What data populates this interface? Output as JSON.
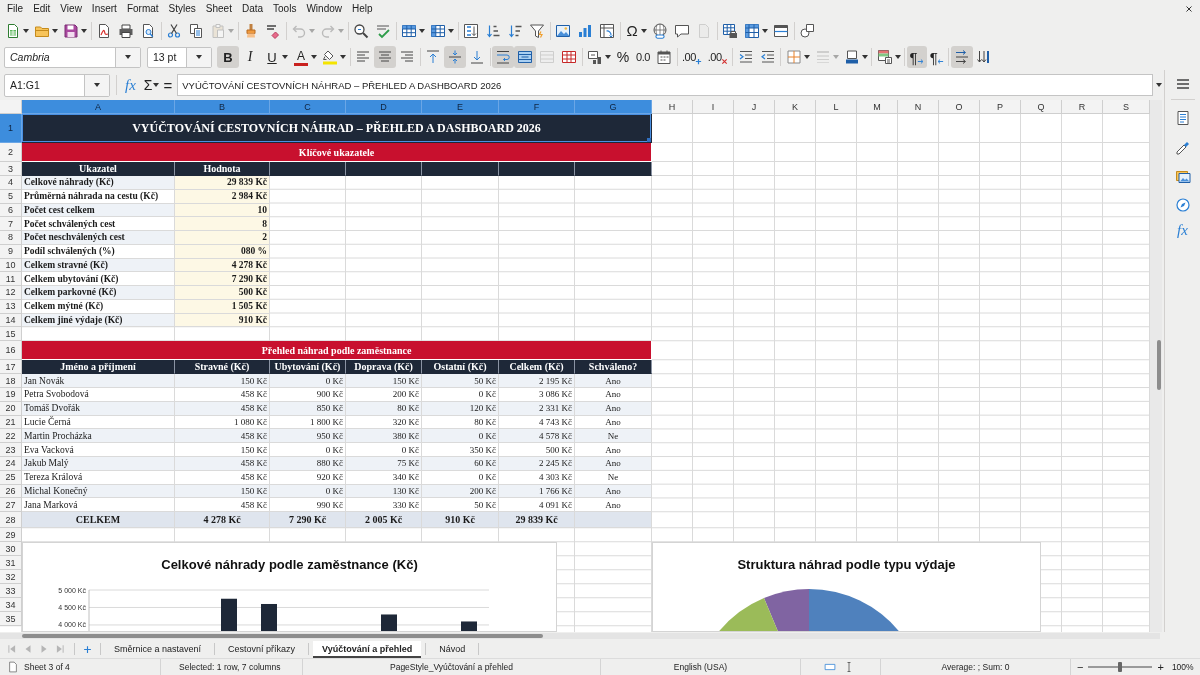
{
  "menu_bar": {
    "items": [
      "File",
      "Edit",
      "View",
      "Insert",
      "Format",
      "Styles",
      "Sheet",
      "Data",
      "Tools",
      "Window",
      "Help"
    ]
  },
  "standard_toolbar": {
    "paste": {
      "disabled": true
    },
    "undo": {
      "disabled": true
    },
    "redo": {
      "disabled": true
    },
    "special_character": {
      "glyph": "Ω"
    },
    "header_footer": {
      "disabled": true
    }
  },
  "formatting_toolbar": {
    "font_name": "Cambria",
    "font_size": "13 pt",
    "bold": {
      "glyph": "B",
      "on": true
    },
    "italic": {
      "glyph": "I",
      "on": false
    },
    "underline": {
      "glyph": "U",
      "on": false
    },
    "font_color": {
      "glyph": "A"
    },
    "align_left": {
      "on": false
    },
    "align_center": {
      "on": true
    },
    "align_right": {
      "on": false
    },
    "align_top": {
      "on": false
    },
    "align_middle": {
      "on": true
    },
    "align_bottom": {
      "on": false
    },
    "wrap_text": {
      "on": true
    },
    "merge_and_center": {
      "on": true
    },
    "merge_cells": {
      "disabled": true
    },
    "percent": {
      "glyph": "%"
    },
    "number_format": {
      "glyph": "0.0"
    },
    "add_decimal": {
      "glyph": ".00"
    },
    "delete_decimal": {
      "glyph": ".00"
    },
    "border_style": {
      "disabled": true
    },
    "left_to_right": {
      "glyph": "¶",
      "on": true
    },
    "right_to_left": {
      "glyph": "¶",
      "on": false
    },
    "horizontal_text": {
      "on": true
    },
    "vertical_text": {
      "on": false
    }
  },
  "formula_bar": {
    "name_box": "A1:G1",
    "function_wizard": "fx",
    "sum": "Σ",
    "equals": "=",
    "content": "VYÚČTOVÁNÍ CESTOVNÍCH NÁHRAD – PŘEHLED A DASHBOARD 2026"
  },
  "sidebar": {
    "functions": "fx"
  },
  "sheet": {
    "columns": [
      {
        "label": "A",
        "selected": true
      },
      {
        "label": "B",
        "selected": true
      },
      {
        "label": "C",
        "selected": true
      },
      {
        "label": "D",
        "selected": true
      },
      {
        "label": "E",
        "selected": true
      },
      {
        "label": "F",
        "selected": true
      },
      {
        "label": "G",
        "selected": true
      },
      {
        "label": "H",
        "selected": false
      },
      {
        "label": "I",
        "selected": false
      },
      {
        "label": "J",
        "selected": false
      },
      {
        "label": "K",
        "selected": false
      },
      {
        "label": "L",
        "selected": false
      },
      {
        "label": "M",
        "selected": false
      },
      {
        "label": "N",
        "selected": false
      },
      {
        "label": "O",
        "selected": false
      },
      {
        "label": "P",
        "selected": false
      },
      {
        "label": "Q",
        "selected": false
      },
      {
        "label": "R",
        "selected": false
      },
      {
        "label": "S",
        "selected": false
      }
    ],
    "rows": [
      {
        "label": "1",
        "selected": true,
        "kind": "title",
        "cells": [
          "VYÚČTOVÁNÍ CESTOVNÍCH NÁHRAD – PŘEHLED A DASHBOARD 2026"
        ]
      },
      {
        "label": "2",
        "selected": false,
        "kind": "section",
        "cells": [
          "Klíčové ukazatele"
        ]
      },
      {
        "label": "3",
        "selected": false,
        "kind": "header",
        "cells": [
          "Ukazatel",
          "Hodnota"
        ]
      },
      {
        "label": "4",
        "selected": false,
        "kind": "kpi",
        "cells": [
          "Celkové náhrady (Kč)",
          "29 839 Kč"
        ]
      },
      {
        "label": "5",
        "selected": false,
        "kind": "kpi",
        "cells": [
          "Průměrná náhrada na cestu (Kč)",
          "2 984 Kč"
        ]
      },
      {
        "label": "6",
        "selected": false,
        "kind": "kpi",
        "cells": [
          "Počet cest celkem",
          "10"
        ]
      },
      {
        "label": "7",
        "selected": false,
        "kind": "kpi",
        "cells": [
          "Počet schválených cest",
          "8"
        ]
      },
      {
        "label": "8",
        "selected": false,
        "kind": "kpi",
        "cells": [
          "Počet neschválených cest",
          "2"
        ]
      },
      {
        "label": "9",
        "selected": false,
        "kind": "kpi",
        "cells": [
          "Podíl schválených (%)",
          "080 %"
        ]
      },
      {
        "label": "10",
        "selected": false,
        "kind": "kpi",
        "cells": [
          "Celkem stravné (Kč)",
          "4 278 Kč"
        ]
      },
      {
        "label": "11",
        "selected": false,
        "kind": "kpi",
        "cells": [
          "Celkem ubytování (Kč)",
          "7 290 Kč"
        ]
      },
      {
        "label": "12",
        "selected": false,
        "kind": "kpi",
        "cells": [
          "Celkem parkovné (Kč)",
          "500 Kč"
        ]
      },
      {
        "label": "13",
        "selected": false,
        "kind": "kpi",
        "cells": [
          "Celkem mýtné (Kč)",
          "1 505 Kč"
        ]
      },
      {
        "label": "14",
        "selected": false,
        "kind": "kpi",
        "cells": [
          "Celkem jiné výdaje (Kč)",
          "910 Kč"
        ]
      },
      {
        "label": "15",
        "selected": false,
        "kind": "blank"
      },
      {
        "label": "16",
        "selected": false,
        "kind": "section",
        "cells": [
          "Přehled náhrad podle zaměstnance"
        ]
      },
      {
        "label": "17",
        "selected": false,
        "kind": "header",
        "cells": [
          "Jméno a příjmení",
          "Stravné (Kč)",
          "Ubytování (Kč)",
          "Doprava (Kč)",
          "Ostatní (Kč)",
          "Celkem (Kč)",
          "Schváleno?"
        ]
      },
      {
        "label": "18",
        "selected": false,
        "kind": "data",
        "cells": [
          "Jan Novák",
          "150 Kč",
          "0 Kč",
          "150 Kč",
          "50 Kč",
          "2 195 Kč",
          "Ano"
        ]
      },
      {
        "label": "19",
        "selected": false,
        "kind": "data",
        "cells": [
          "Petra Svobodová",
          "458 Kč",
          "900 Kč",
          "200 Kč",
          "0 Kč",
          "3 086 Kč",
          "Ano"
        ]
      },
      {
        "label": "20",
        "selected": false,
        "kind": "data",
        "cells": [
          "Tomáš Dvořák",
          "458 Kč",
          "850 Kč",
          "80 Kč",
          "120 Kč",
          "2 331 Kč",
          "Ano"
        ]
      },
      {
        "label": "21",
        "selected": false,
        "kind": "data",
        "cells": [
          "Lucie Černá",
          "1 080 Kč",
          "1 800 Kč",
          "320 Kč",
          "80 Kč",
          "4 743 Kč",
          "Ano"
        ]
      },
      {
        "label": "22",
        "selected": false,
        "kind": "data",
        "cells": [
          "Martin Procházka",
          "458 Kč",
          "950 Kč",
          "380 Kč",
          "0 Kč",
          "4 578 Kč",
          "Ne"
        ]
      },
      {
        "label": "23",
        "selected": false,
        "kind": "data",
        "cells": [
          "Eva Vacková",
          "150 Kč",
          "0 Kč",
          "0 Kč",
          "350 Kč",
          "500 Kč",
          "Ano"
        ]
      },
      {
        "label": "24",
        "selected": false,
        "kind": "data",
        "cells": [
          "Jakub Malý",
          "458 Kč",
          "880 Kč",
          "75 Kč",
          "60 Kč",
          "2 245 Kč",
          "Ano"
        ]
      },
      {
        "label": "25",
        "selected": false,
        "kind": "data",
        "cells": [
          "Tereza Králová",
          "458 Kč",
          "920 Kč",
          "340 Kč",
          "0 Kč",
          "4 303 Kč",
          "Ne"
        ]
      },
      {
        "label": "26",
        "selected": false,
        "kind": "data",
        "cells": [
          "Michal Konečný",
          "150 Kč",
          "0 Kč",
          "130 Kč",
          "200 Kč",
          "1 766 Kč",
          "Ano"
        ]
      },
      {
        "label": "27",
        "selected": false,
        "kind": "data",
        "cells": [
          "Jana Marková",
          "458 Kč",
          "990 Kč",
          "330 Kč",
          "50 Kč",
          "4 091 Kč",
          "Ano"
        ]
      },
      {
        "label": "28",
        "selected": false,
        "kind": "total",
        "cells": [
          "CELKEM",
          "4 278 Kč",
          "7 290 Kč",
          "2 005 Kč",
          "910 Kč",
          "29 839 Kč"
        ]
      },
      {
        "label": "29",
        "selected": false,
        "kind": "blank"
      },
      {
        "label": "30",
        "selected": false,
        "kind": "blank"
      },
      {
        "label": "31",
        "selected": false,
        "kind": "blank"
      },
      {
        "label": "32",
        "selected": false,
        "kind": "blank"
      },
      {
        "label": "33",
        "selected": false,
        "kind": "blank"
      },
      {
        "label": "34",
        "selected": false,
        "kind": "blank"
      },
      {
        "label": "35",
        "selected": false,
        "kind": "blank"
      }
    ]
  },
  "bar_chart": {
    "chart_data": {
      "type": "bar",
      "title": "Celkové náhrady podle zaměstnance (Kč)",
      "ylim": [
        3770,
        5000
      ],
      "yticks": [
        {
          "value": 4000,
          "label": "4 000 Kč"
        },
        {
          "value": 4500,
          "label": "4 500 Kč"
        },
        {
          "value": 5000,
          "label": "5 000 Kč"
        }
      ],
      "values": [
        null,
        null,
        null,
        4750,
        4600,
        null,
        null,
        4300,
        null,
        4100
      ]
    }
  },
  "pie_chart": {
    "title": "Struktura náhrad podle typu výdaje"
  },
  "sheet_tabs": [
    {
      "label": "Směrnice a nastavení",
      "selected": false
    },
    {
      "label": "Cestovní příkazy",
      "selected": false
    },
    {
      "label": "Vyúčtování a přehled",
      "selected": true
    },
    {
      "label": "Návod",
      "selected": false
    }
  ],
  "status_bar": {
    "sheet": "Sheet 3 of 4",
    "selection": "Selected: 1 row, 7 columns",
    "page_style": "PageStyle_Vyúčtování a přehled",
    "language": "English (USA)",
    "summary": "Average: ; Sum: 0",
    "zoom_out": "−",
    "zoom_slider": {
      "level": 0.5
    },
    "zoom_in": "+",
    "zoom": "100%"
  }
}
